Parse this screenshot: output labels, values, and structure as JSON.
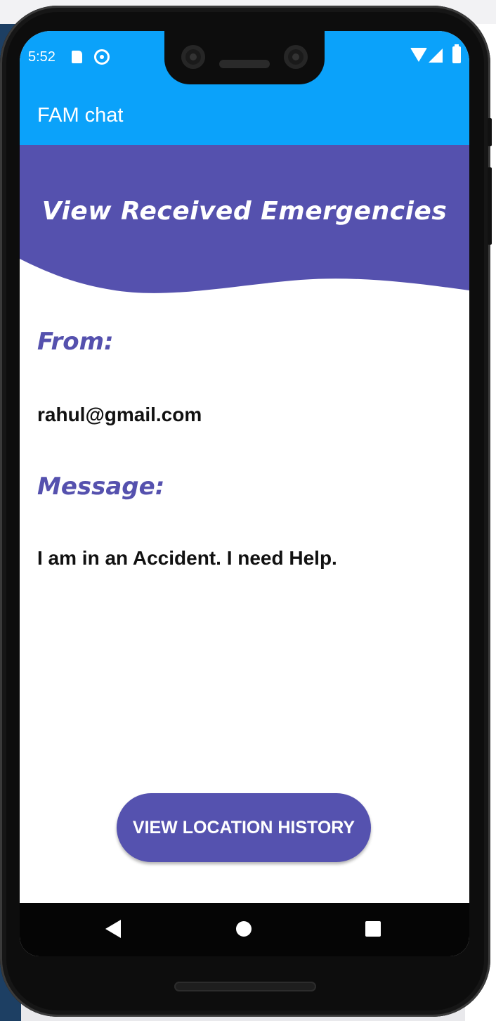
{
  "status_bar": {
    "time": "5:52"
  },
  "app_bar": {
    "title": "FAM chat"
  },
  "header": {
    "title": "View Received Emergencies"
  },
  "from": {
    "label": "From:",
    "value": "rahul@gmail.com"
  },
  "message": {
    "label": "Message:",
    "value": "I am in an Accident. I need Help."
  },
  "actions": {
    "view_location_history": "VIEW LOCATION HISTORY"
  },
  "nav_bar": {
    "icons": [
      "back-icon",
      "home-icon",
      "recents-icon"
    ]
  },
  "colors": {
    "app_bar": "#0ba2fa",
    "accent": "#5552af",
    "label_text": "#5551ae"
  }
}
